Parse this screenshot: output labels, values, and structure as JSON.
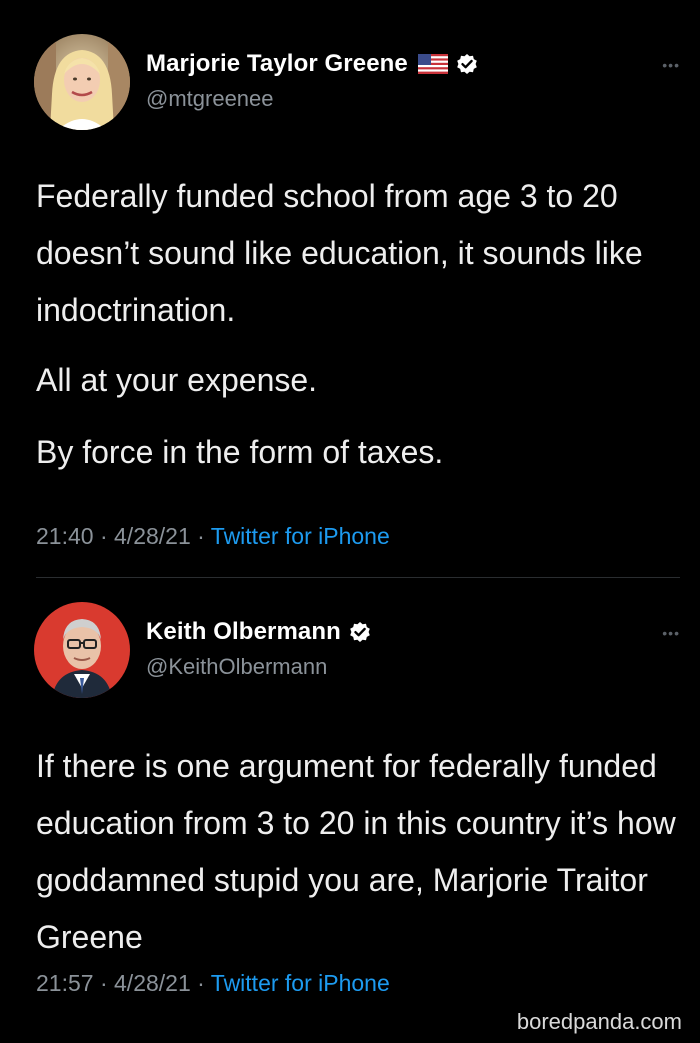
{
  "tweets": [
    {
      "author": {
        "display_name": "Marjorie Taylor Greene",
        "handle": "@mtgreenee",
        "verified": true,
        "flag": "us-flag-icon"
      },
      "paragraphs": [
        "Federally funded school from age 3 to 20 doesn’t sound like education, it sounds like indoctrination.",
        "All at your expense.",
        "By force in the form of taxes."
      ],
      "meta": {
        "time": "21:40",
        "date": "4/28/21",
        "source": "Twitter for iPhone"
      },
      "more_icon": "more-options-icon"
    },
    {
      "author": {
        "display_name": "Keith Olbermann",
        "handle": "@KeithOlbermann",
        "verified": true
      },
      "paragraphs": [
        "If there is one argument for federally funded education from 3 to 20 in this country it’s how goddamned stupid you are, Marjorie Traitor Greene"
      ],
      "meta": {
        "time": "21:57",
        "date": "4/28/21",
        "source": "Twitter for iPhone"
      },
      "more_icon": "more-options-icon"
    }
  ],
  "separator": " · ",
  "watermark": "boredpanda.com",
  "colors": {
    "background": "#000000",
    "text": "#eeeeee",
    "secondary": "#8b9299",
    "link": "#1d9bf0",
    "verified": "#ffffff"
  }
}
